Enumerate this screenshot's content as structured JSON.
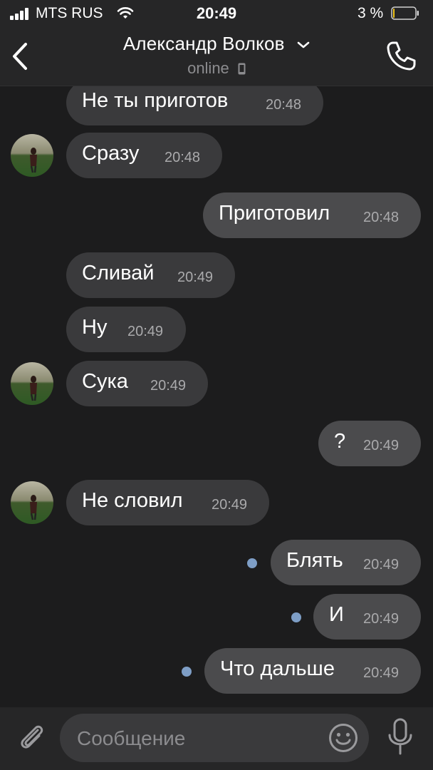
{
  "status_bar": {
    "carrier": "MTS RUS",
    "time": "20:49",
    "battery_percent": "3 %",
    "battery_level": 0.03,
    "battery_color": "#f0c419",
    "icons": [
      "signal-icon",
      "wifi-icon",
      "battery-icon"
    ]
  },
  "header": {
    "contact_name": "Александр Волков",
    "status": "online",
    "icons": [
      "back-arrow-icon",
      "chevron-down-icon",
      "mobile-phone-icon",
      "call-icon"
    ]
  },
  "messages": [
    {
      "direction": "in",
      "text": "Не ты приготов",
      "time": "20:48",
      "avatar": false
    },
    {
      "direction": "in",
      "text": "Сразу",
      "time": "20:48",
      "avatar": true
    },
    {
      "direction": "out",
      "text": "Приготовил",
      "time": "20:48",
      "unread": false
    },
    {
      "direction": "in",
      "text": "Сливай",
      "time": "20:49",
      "avatar": false
    },
    {
      "direction": "in",
      "text": "Ну",
      "time": "20:49",
      "avatar": false
    },
    {
      "direction": "in",
      "text": "Сука",
      "time": "20:49",
      "avatar": true
    },
    {
      "direction": "out",
      "text": "?",
      "time": "20:49",
      "unread": false
    },
    {
      "direction": "in",
      "text": "Не словил",
      "time": "20:49",
      "avatar": true
    },
    {
      "direction": "out",
      "text": "Блять",
      "time": "20:49",
      "unread": true
    },
    {
      "direction": "out",
      "text": "И",
      "time": "20:49",
      "unread": true
    },
    {
      "direction": "out",
      "text": "Что дальше",
      "time": "20:49",
      "unread": true
    }
  ],
  "composer": {
    "placeholder": "Сообщение",
    "icons": [
      "paperclip-icon",
      "emoji-icon",
      "microphone-icon"
    ]
  },
  "colors": {
    "background": "#1c1c1d",
    "bar": "#262627",
    "bubble_in": "#3a3a3c",
    "bubble_out": "#4b4b4d",
    "unread_dot": "#7e9ec6",
    "secondary_text": "#8c8c8f"
  }
}
